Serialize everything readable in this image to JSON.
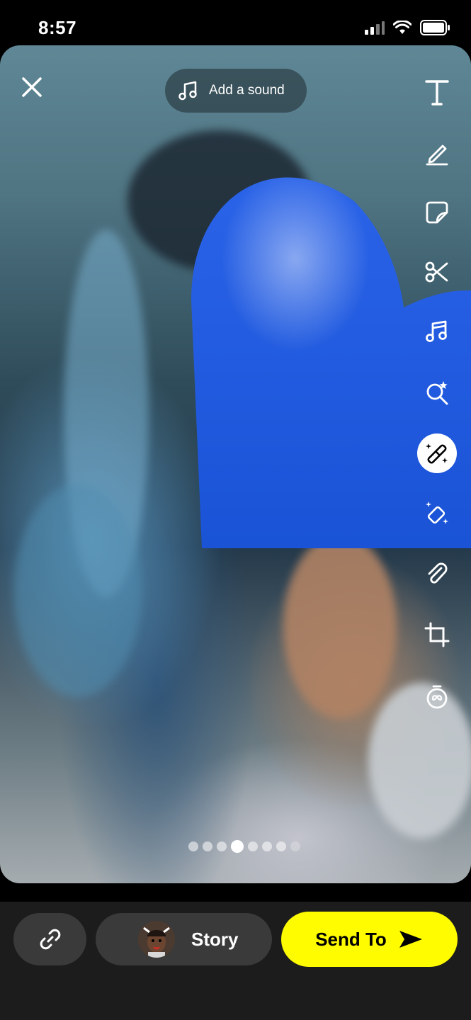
{
  "status_bar": {
    "time": "8:57"
  },
  "editor": {
    "sound_label": "Add a sound",
    "tools": [
      "text-tool-icon",
      "pen-tool-icon",
      "sticker-tool-icon",
      "scissors-tool-icon",
      "music-tool-icon",
      "lens-search-tool-icon",
      "magic-wand-tool-icon",
      "magic-eraser-tool-icon",
      "paperclip-tool-icon",
      "crop-tool-icon",
      "timer-tool-icon"
    ],
    "active_tool": "magic-wand-tool-icon",
    "pages": {
      "count": 8,
      "current": 4
    }
  },
  "bottom_bar": {
    "story_label": "Story",
    "send_label": "Send To"
  },
  "colors": {
    "send_button": "#fffc00",
    "heart": "#1a5be0"
  }
}
